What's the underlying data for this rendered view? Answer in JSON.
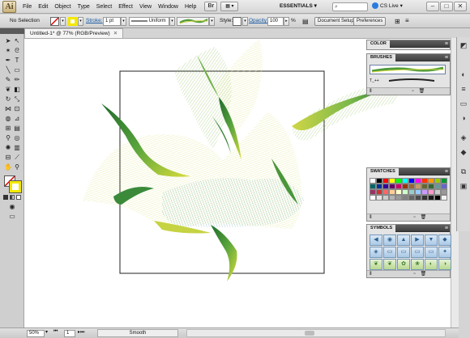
{
  "menubar": {
    "logo": "Ai",
    "items": [
      "File",
      "Edit",
      "Object",
      "Type",
      "Select",
      "Effect",
      "View",
      "Window",
      "Help"
    ],
    "bridge_label": "Br",
    "arrange_label": "▦ ▾",
    "workspace": "ESSENTIALS ▾",
    "search_placeholder": "",
    "cs_live": "CS Live ▾",
    "window_buttons": [
      "–",
      "□",
      "✕"
    ]
  },
  "controlbar": {
    "selection": "No Selection",
    "stroke_label": "Stroke:",
    "stroke_value": "1 pt",
    "stroke_profile": "Uniform",
    "style_label": "Style:",
    "opacity_label": "Opacity:",
    "opacity_value": "100",
    "opacity_unit": "%",
    "document_setup": "Document Setup",
    "preferences": "Preferences"
  },
  "document": {
    "tab_title": "Untitled-1* @ 77% (RGB/Preview)",
    "close": "✕"
  },
  "panels": {
    "color": {
      "title": "COLOR"
    },
    "brushes": {
      "title": "BRUSHES",
      "brush_label": "T_++"
    },
    "swatches": {
      "title": "SWATCHES"
    },
    "symbols": {
      "title": "SYMBOLS"
    }
  },
  "statusbar": {
    "zoom": "50%",
    "page": "1",
    "status": "Smooth"
  },
  "colors": {
    "accent": "#1d5fa6",
    "art_green_dark": "#2d7a2f",
    "art_yellow": "#d8dc3a",
    "art_teal": "#3f8f8a"
  }
}
